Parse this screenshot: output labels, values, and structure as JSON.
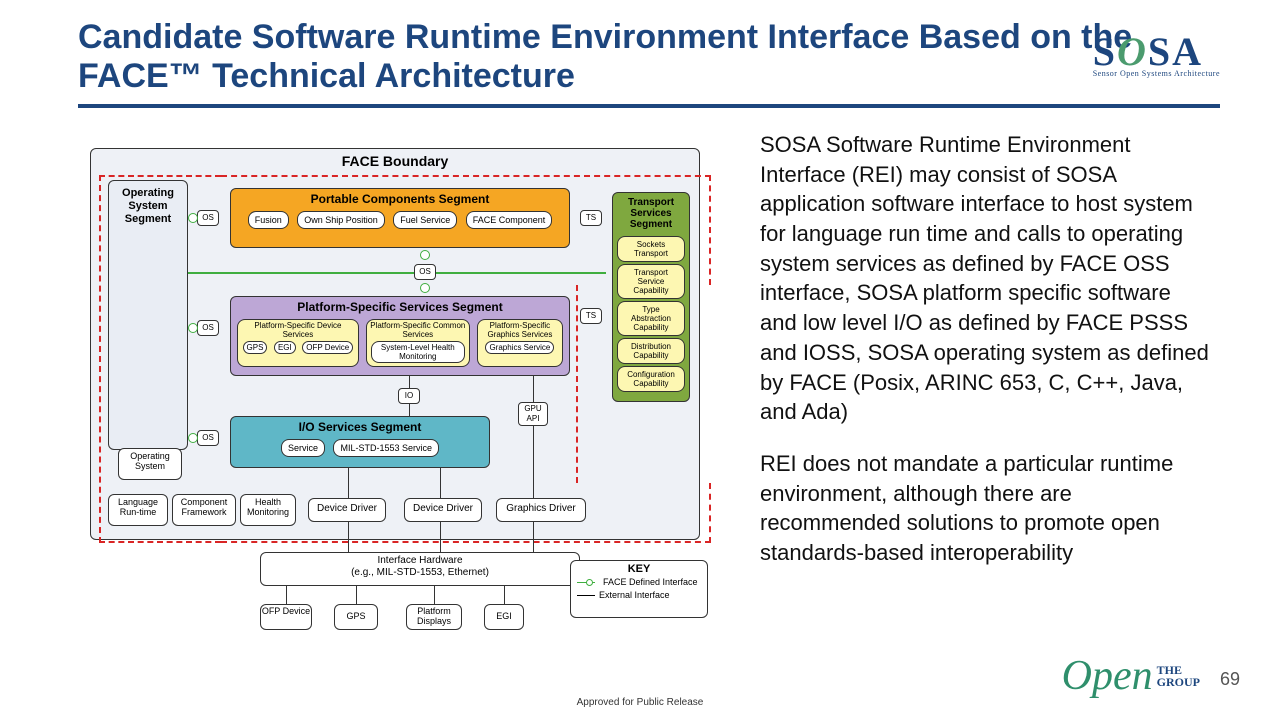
{
  "title": "Candidate Software Runtime Environment Interface Based on the FACE™ Technical Architecture",
  "logo": {
    "text1": "S",
    "text2": "O",
    "text3": "SA",
    "tag": "Sensor Open Systems Architecture"
  },
  "paragraphs": {
    "p1": "SOSA Software Runtime Environment Interface (REI) may consist of SOSA application software interface to host system for language run time and calls to operating system services as defined by FACE OSS interface, SOSA platform specific software and low level I/O as defined by FACE PSSS and IOSS, SOSA operating system as defined by FACE (Posix, ARINC 653, C, C++, Java, and Ada)",
    "p2": "REI does not mandate a particular runtime environment, although there are recommended solutions to promote open standards-based interoperability"
  },
  "pageno": "69",
  "release": "Approved for Public Release",
  "opengroup": {
    "the": "THE",
    "open": "Open",
    "group": "GROUP"
  },
  "diagram": {
    "boundary": "FACE Boundary",
    "oss_label": "Operating System Segment",
    "pcs": {
      "title": "Portable Components Segment",
      "items": [
        "Fusion",
        "Own Ship Position",
        "Fuel Service",
        "FACE Component"
      ]
    },
    "psss": {
      "title": "Platform-Specific Services Segment",
      "devsvc": "Platform-Specific Device Services",
      "devitems": [
        "GPS",
        "EGI",
        "OFP Device"
      ],
      "common": "Platform-Specific Common Services",
      "commonitems": [
        "System-Level Health Monitoring"
      ],
      "graphics": "Platform-Specific Graphics Services",
      "graphicsitems": [
        "Graphics Service"
      ]
    },
    "ioss": {
      "title": "I/O Services Segment",
      "items": [
        "Service",
        "MIL-STD-1553 Service"
      ]
    },
    "tss": {
      "title": "Transport Services Segment",
      "items": [
        "Sockets Transport",
        "Transport Service Capability",
        "Type Abstraction Capability",
        "Distribution Capability",
        "Configuration Capability"
      ]
    },
    "os": "OS",
    "ts": "TS",
    "io": "IO",
    "gpu": "GPU API",
    "bottom": {
      "os": "Operating System",
      "lang": "Language Run-time",
      "comp": "Component Framework",
      "health": "Health Monitoring",
      "dd": "Device Driver",
      "gd": "Graphics Driver"
    },
    "ifhw": {
      "title": "Interface Hardware",
      "sub": "(e.g., MIL-STD-1553, Ethernet)",
      "items": [
        "OFP Device",
        "GPS",
        "Platform Displays",
        "EGI"
      ]
    },
    "key": {
      "title": "KEY",
      "face": "FACE Defined Interface",
      "ext": "External Interface"
    }
  }
}
